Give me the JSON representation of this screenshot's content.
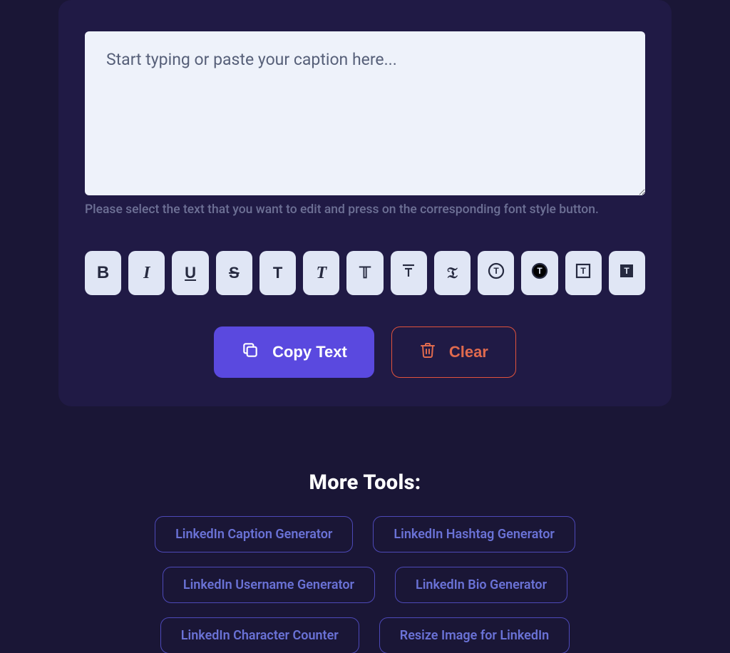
{
  "editor": {
    "placeholder": "Start typing or paste your caption here...",
    "value": "",
    "hint": "Please select the text that you want to edit and press on the corresponding font style button."
  },
  "formatButtons": [
    {
      "name": "bold-button"
    },
    {
      "name": "italic-button"
    },
    {
      "name": "underline-button"
    },
    {
      "name": "strikethrough-button"
    },
    {
      "name": "sans-style-button"
    },
    {
      "name": "script-style-button"
    },
    {
      "name": "doublestruck-style-button"
    },
    {
      "name": "monospace-style-button"
    },
    {
      "name": "fraktur-style-button"
    },
    {
      "name": "circled-style-button"
    },
    {
      "name": "filled-circle-style-button"
    },
    {
      "name": "squared-style-button"
    },
    {
      "name": "filled-square-style-button"
    }
  ],
  "actions": {
    "copy": "Copy Text",
    "clear": "Clear"
  },
  "moreTools": {
    "heading": "More Tools:",
    "links": [
      "LinkedIn Caption Generator",
      "LinkedIn Hashtag Generator",
      "LinkedIn Username Generator",
      "LinkedIn Bio Generator",
      "LinkedIn Character Counter",
      "Resize Image for LinkedIn"
    ]
  },
  "colors": {
    "pageBg": "#1a1636",
    "panelBg": "#201a45",
    "inputBg": "#eef2fa",
    "buttonBg": "#e0e6f5",
    "primary": "#5a49df",
    "danger": "#e1533c",
    "linkBorder": "#4d49b8",
    "linkText": "#6a72d6"
  }
}
